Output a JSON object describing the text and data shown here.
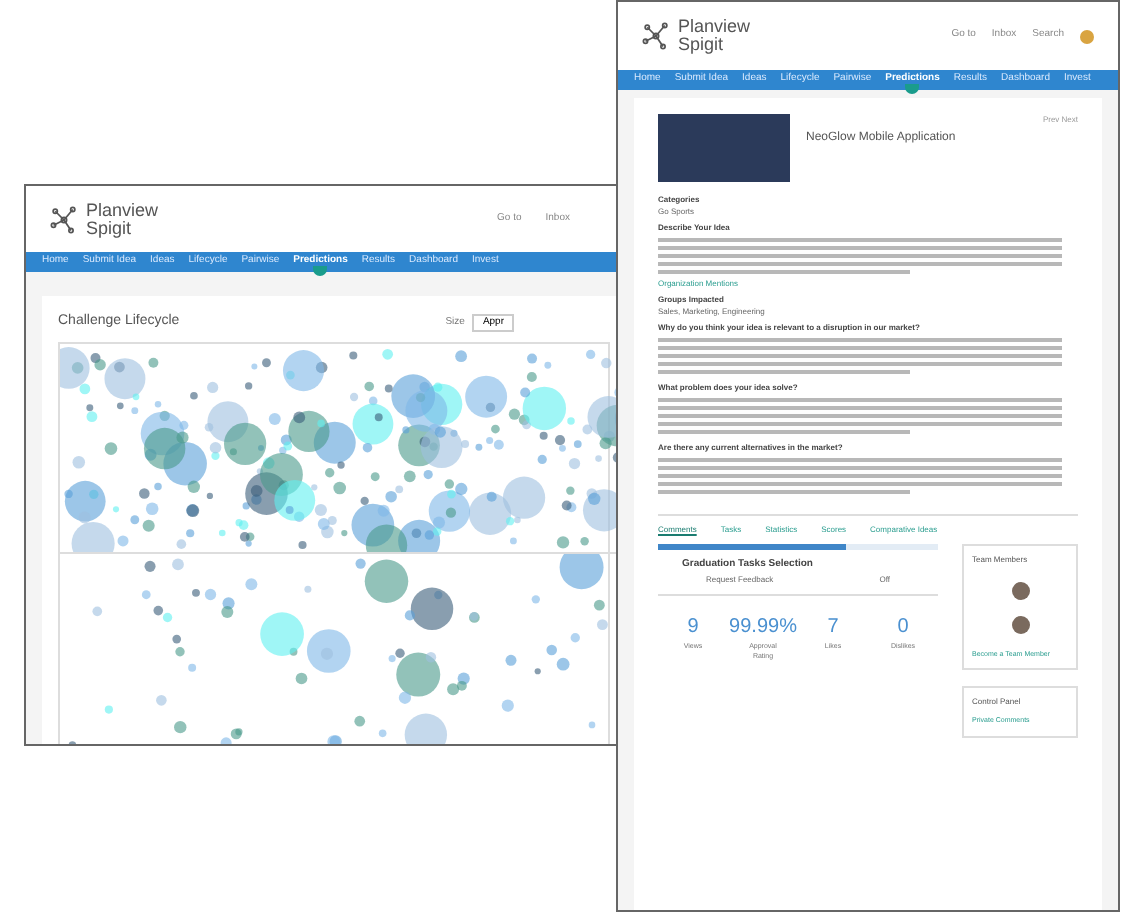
{
  "back_window": {
    "logo": {
      "line_1": "Planview",
      "line_2": "Spigit"
    },
    "header_links": [
      "Go to",
      "Inbox"
    ],
    "nav": [
      {
        "label": "Home",
        "selected": false
      },
      {
        "label": "Submit Idea",
        "selected": false
      },
      {
        "label": "Ideas",
        "selected": false
      },
      {
        "label": "Lifecycle",
        "selected": false
      },
      {
        "label": "Pairwise",
        "selected": false
      },
      {
        "label": "Predictions",
        "selected": true
      },
      {
        "label": "Results",
        "selected": false
      },
      {
        "label": "Dashboard",
        "selected": false
      },
      {
        "label": "Invest",
        "selected": false
      }
    ],
    "title": "Challenge Lifecycle",
    "size_label": "Size",
    "size_value": "Appr"
  },
  "front_window": {
    "logo": {
      "line_1": "Planview",
      "line_2": "Spigit"
    },
    "header_links": [
      "Go to",
      "Inbox",
      "Search"
    ],
    "nav": [
      {
        "label": "Home",
        "selected": false
      },
      {
        "label": "Submit Idea",
        "selected": false
      },
      {
        "label": "Ideas",
        "selected": false
      },
      {
        "label": "Lifecycle",
        "selected": false
      },
      {
        "label": "Pairwise",
        "selected": false
      },
      {
        "label": "Predictions",
        "selected": true
      },
      {
        "label": "Results",
        "selected": false
      },
      {
        "label": "Dashboard",
        "selected": false
      },
      {
        "label": "Invest",
        "selected": false
      }
    ],
    "idea_title": "NeoGlow Mobile Application",
    "pager": "Prev Next",
    "sections": [
      {
        "kind": "heading",
        "text": "Categories"
      },
      {
        "kind": "value",
        "text": "Go Sports"
      },
      {
        "kind": "heading",
        "text": "Describe Your Idea"
      },
      {
        "kind": "paragraph"
      },
      {
        "kind": "link",
        "text": "Organization Mentions"
      },
      {
        "kind": "heading",
        "text": "Groups Impacted"
      },
      {
        "kind": "value",
        "text": "Sales, Marketing, Engineering"
      },
      {
        "kind": "heading",
        "text": "Why do you think your idea is relevant to a disruption in our market?"
      },
      {
        "kind": "paragraph"
      },
      {
        "kind": "heading",
        "text": "What problem does your idea solve?"
      },
      {
        "kind": "paragraph"
      },
      {
        "kind": "heading",
        "text": "Are there any current alternatives in the market?"
      },
      {
        "kind": "paragraph"
      }
    ],
    "bottom_tabs": [
      {
        "label": "Comments",
        "selected": true
      },
      {
        "label": "Tasks",
        "selected": false
      },
      {
        "label": "Statistics",
        "selected": false
      },
      {
        "label": "Scores",
        "selected": false
      },
      {
        "label": "Comparative Ideas",
        "selected": false
      }
    ],
    "progress": {
      "level": 0.67
    },
    "graduation": {
      "title": "Graduation Tasks Selection",
      "item": "Request Feedback",
      "state": "Off"
    },
    "stats": [
      {
        "value": "9",
        "label": "Views"
      },
      {
        "value": "99.99%",
        "label": "Approval Rating"
      },
      {
        "value": "7",
        "label": "Likes"
      },
      {
        "value": "0",
        "label": "Dislikes"
      }
    ],
    "team": {
      "title": "Team Members",
      "link": "Become a Team Member"
    },
    "control_panel": {
      "title": "Control Panel",
      "link": "Private Comments"
    }
  }
}
